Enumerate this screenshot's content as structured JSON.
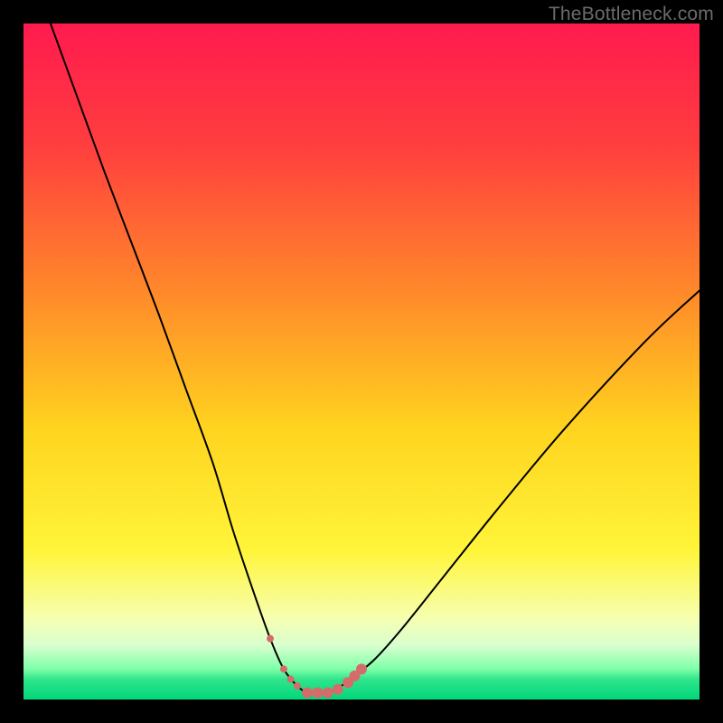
{
  "watermark": "TheBottleneck.com",
  "chart_data": {
    "type": "line",
    "title": "",
    "xlabel": "",
    "ylabel": "",
    "xlim": [
      0,
      100
    ],
    "ylim": [
      0,
      100
    ],
    "background_gradient": {
      "stops": [
        {
          "offset": 0.0,
          "color": "#ff1a4f"
        },
        {
          "offset": 0.18,
          "color": "#ff3e3e"
        },
        {
          "offset": 0.4,
          "color": "#ff8a2a"
        },
        {
          "offset": 0.6,
          "color": "#ffd41f"
        },
        {
          "offset": 0.78,
          "color": "#fff53a"
        },
        {
          "offset": 0.88,
          "color": "#f6ffb0"
        },
        {
          "offset": 0.92,
          "color": "#d8ffcf"
        },
        {
          "offset": 0.955,
          "color": "#7effa8"
        },
        {
          "offset": 0.97,
          "color": "#30e58c"
        },
        {
          "offset": 1.0,
          "color": "#00d779"
        }
      ]
    },
    "series": [
      {
        "name": "bottleneck-curve",
        "x": [
          4,
          8,
          12,
          16,
          20,
          24,
          28,
          31,
          34,
          36.5,
          38.5,
          40.5,
          42,
          43.5,
          45,
          47,
          49,
          52,
          56,
          62,
          70,
          80,
          92,
          100
        ],
        "y": [
          100,
          89,
          78,
          67.5,
          57,
          46,
          35,
          25,
          16,
          9,
          4.5,
          2,
          1,
          1,
          1,
          2,
          3.5,
          6,
          10.5,
          18,
          28,
          40,
          53,
          60.5
        ],
        "stroke": "#000000",
        "stroke_width": 2
      }
    ],
    "markers": {
      "name": "bottom-cluster",
      "color": "#d66b6b",
      "radius_small": 4,
      "radius_large": 6,
      "points": [
        {
          "x": 36.5,
          "y": 9,
          "r": "small"
        },
        {
          "x": 38.5,
          "y": 4.5,
          "r": "small"
        },
        {
          "x": 39.5,
          "y": 3,
          "r": "small"
        },
        {
          "x": 40.5,
          "y": 2,
          "r": "small"
        },
        {
          "x": 42,
          "y": 1,
          "r": "large"
        },
        {
          "x": 43.5,
          "y": 1,
          "r": "large"
        },
        {
          "x": 45,
          "y": 1,
          "r": "large"
        },
        {
          "x": 46.5,
          "y": 1.5,
          "r": "large"
        },
        {
          "x": 48,
          "y": 2.5,
          "r": "large"
        },
        {
          "x": 49,
          "y": 3.5,
          "r": "large"
        },
        {
          "x": 50,
          "y": 4.5,
          "r": "large"
        }
      ]
    }
  }
}
